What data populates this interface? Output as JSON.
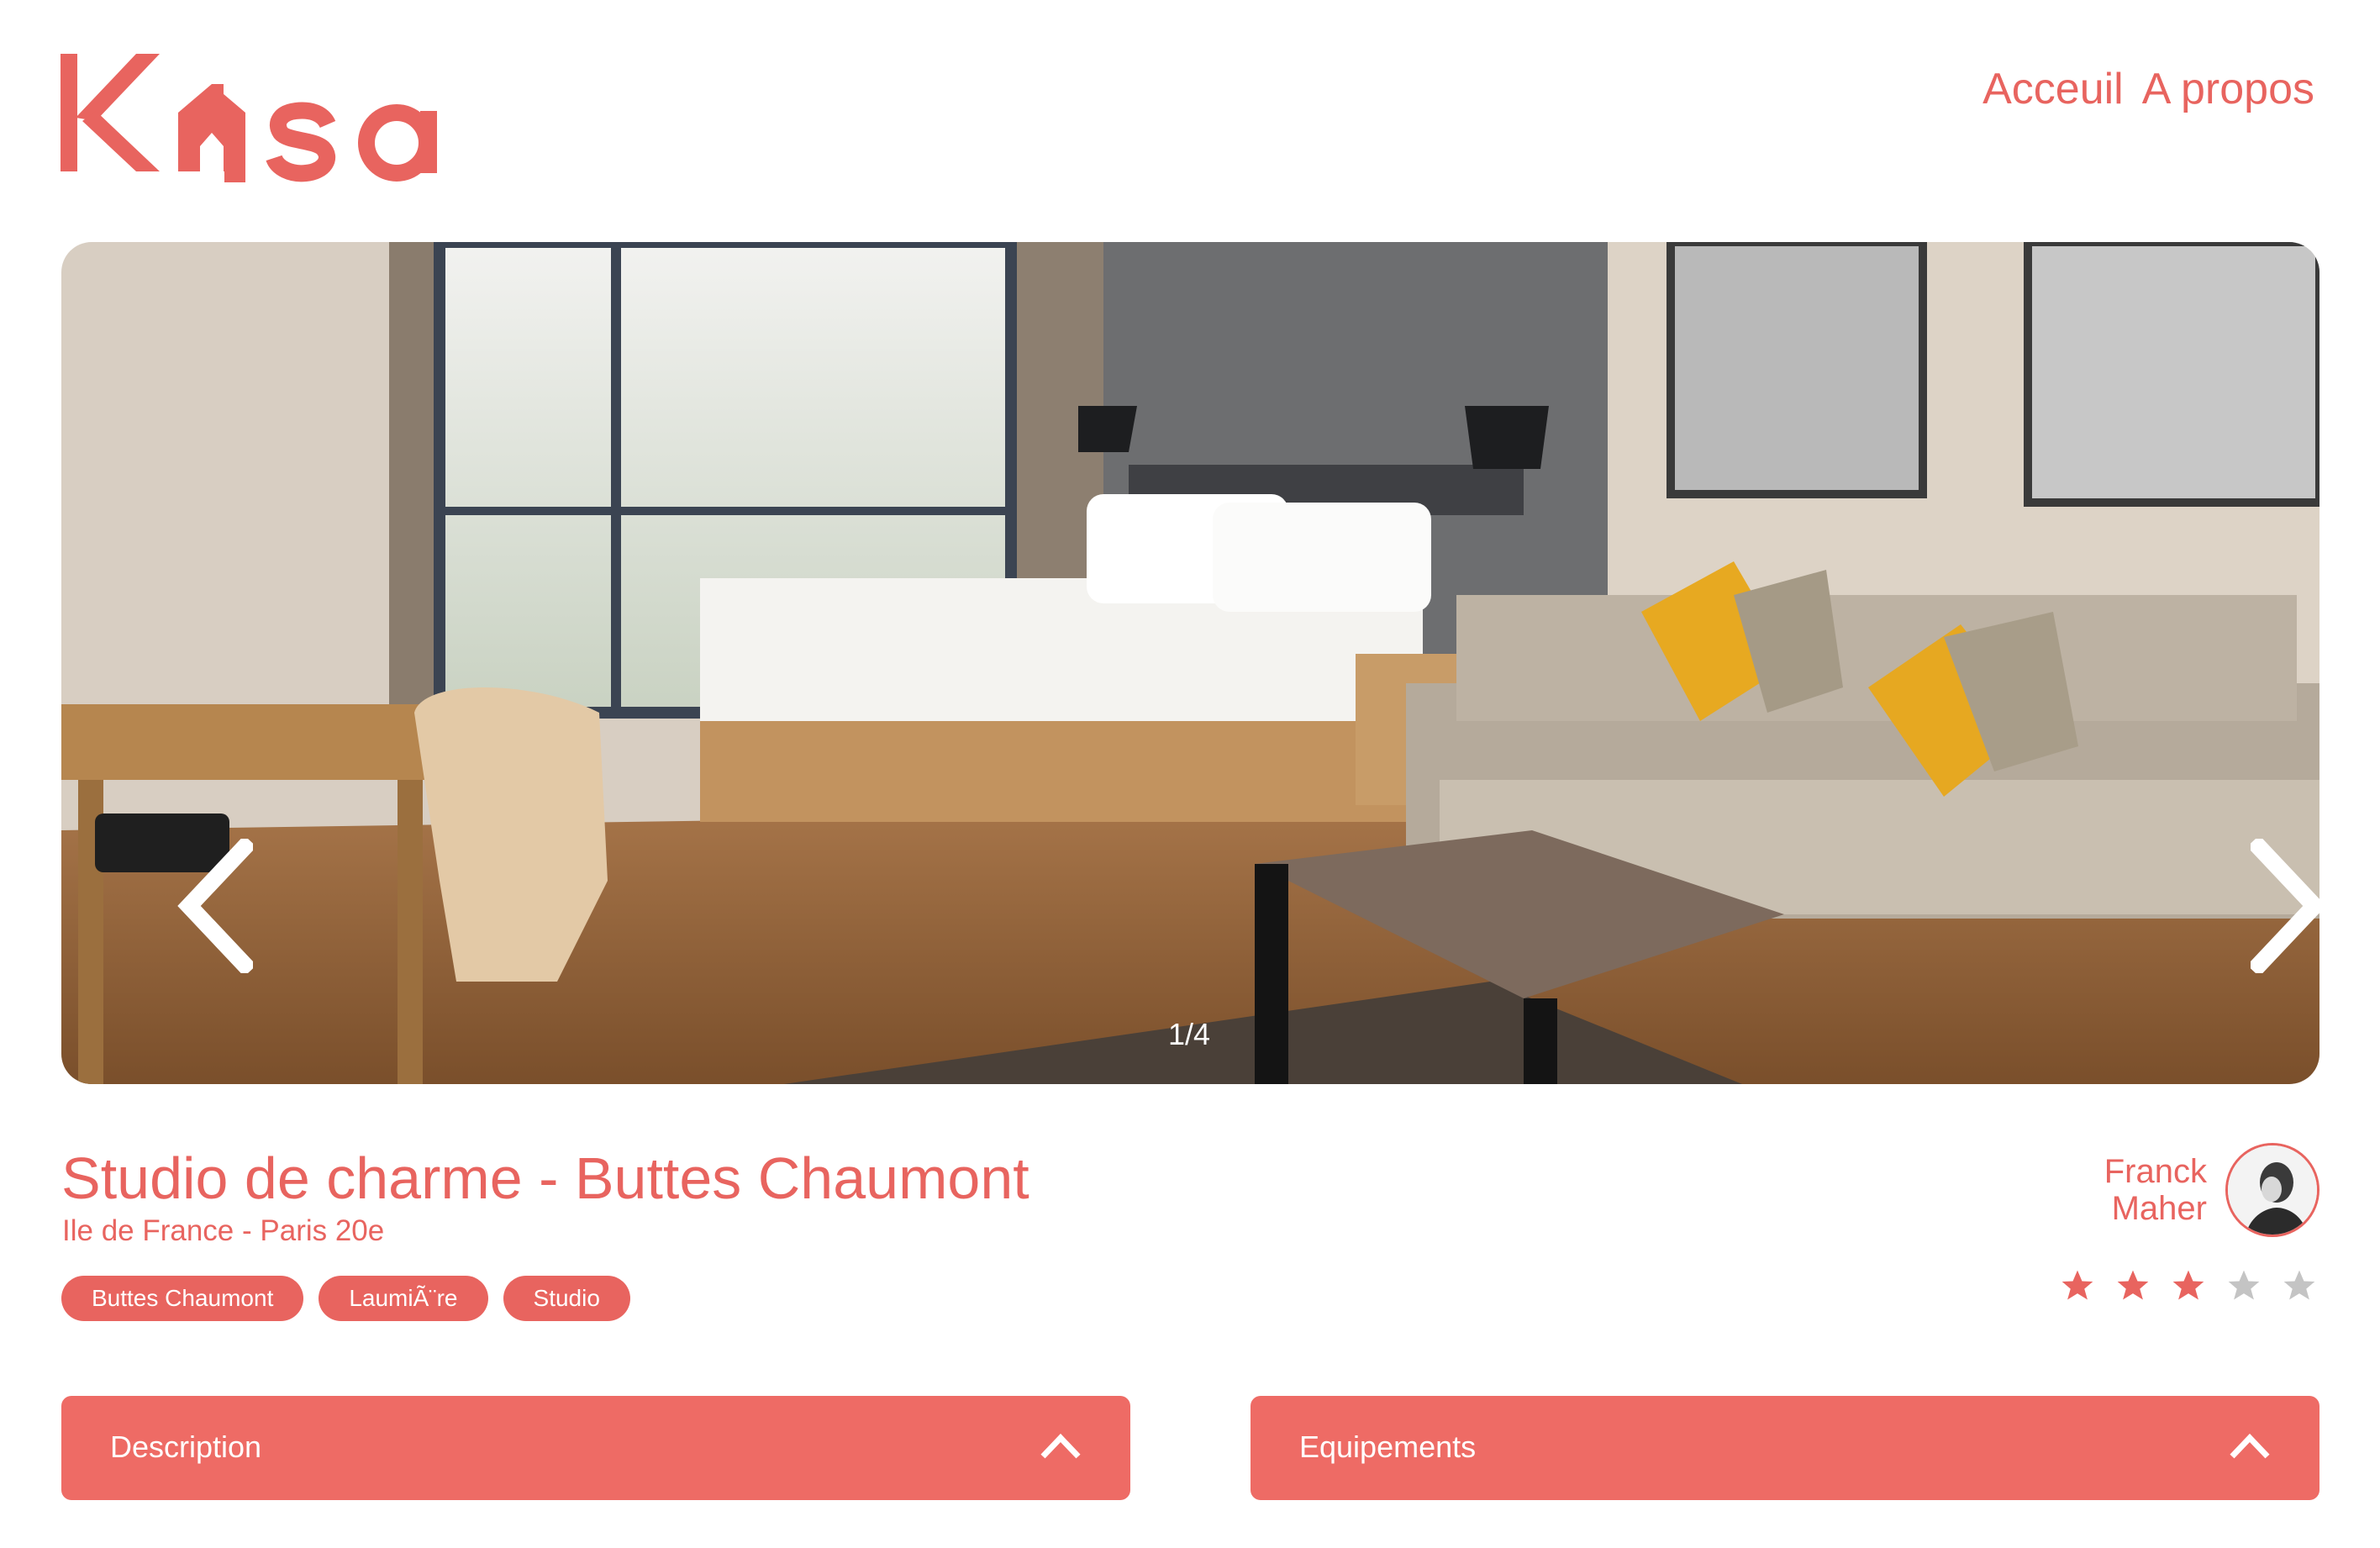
{
  "brand": {
    "name": "Kasa",
    "color": "#E8645F"
  },
  "nav": {
    "home": "Acceuil",
    "about": "A propos"
  },
  "gallery": {
    "counter": "1/4",
    "prev_icon": "chevron-left-icon",
    "next_icon": "chevron-right-icon"
  },
  "listing": {
    "title": "Studio de charme - Buttes Chaumont",
    "location": "Ile de France - Paris 20e",
    "tags": [
      "Buttes Chaumont",
      "LaumiÃ¨re",
      "Studio"
    ]
  },
  "host": {
    "first_name": "Franck",
    "last_name": "Maher"
  },
  "rating": {
    "value": 3,
    "max": 5,
    "active_color": "#E8645F",
    "inactive_color": "#C4C4C4"
  },
  "collapses": {
    "description": "Description",
    "equipments": "Equipements"
  }
}
